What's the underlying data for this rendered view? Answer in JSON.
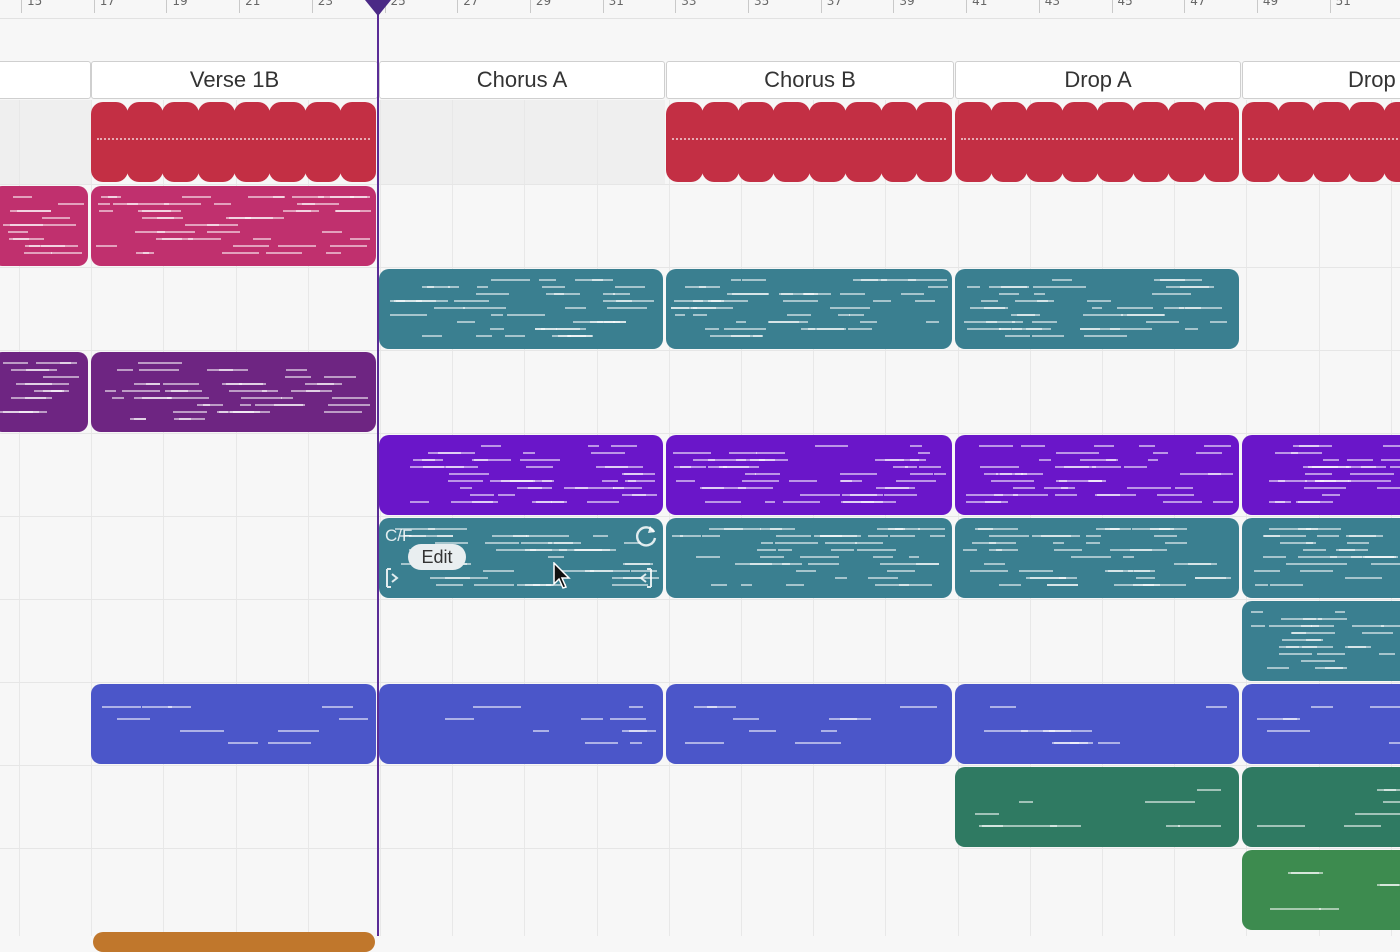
{
  "timeline": {
    "bar_numbers": [
      "15",
      "17",
      "19",
      "21",
      "23",
      "25",
      "27",
      "29",
      "31",
      "33",
      "35",
      "37",
      "39",
      "41",
      "43",
      "45",
      "47",
      "49",
      "51"
    ]
  },
  "sections": [
    {
      "name": ""
    },
    {
      "name": "Verse 1B"
    },
    {
      "name": "Chorus A"
    },
    {
      "name": "Chorus B"
    },
    {
      "name": "Drop A"
    },
    {
      "name": "Drop"
    }
  ],
  "selected_clip": {
    "key": "C/F",
    "edit_label": "Edit",
    "loop_icon": "loop-icon",
    "trim_left_icon": "trim-start-icon",
    "trim_right_icon": "trim-end-icon"
  },
  "colors": {
    "drums": "#c32f44",
    "keys": "#c0306e",
    "bass_teal": "#3a7f90",
    "plum": "#6e2582",
    "violet": "#6a16c9",
    "blue": "#4b56c9",
    "green": "#2f7a62",
    "green_light": "#3d8b4f",
    "orange": "#c0772c",
    "playhead": "#4b2a86"
  }
}
